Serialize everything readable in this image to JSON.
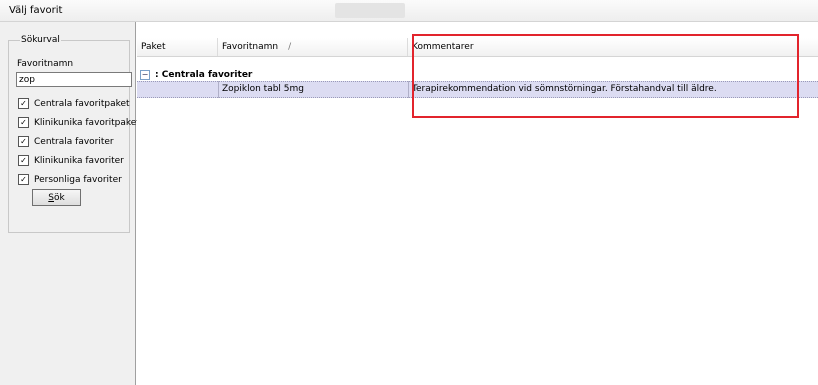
{
  "window": {
    "title": "Välj favorit"
  },
  "search": {
    "group_label": "Sökurval",
    "name_label": "Favoritnamn",
    "name_value": "zop",
    "checkboxes": [
      {
        "label": "Centrala favoritpaket",
        "checked": true,
        "mark": "✓"
      },
      {
        "label": "Klinikunika favoritpaket",
        "checked": true,
        "mark": "✓"
      },
      {
        "label": "Centrala favoriter",
        "checked": true,
        "mark": "✓"
      },
      {
        "label": "Klinikunika favoriter",
        "checked": true,
        "mark": "✓"
      },
      {
        "label": "Personliga favoriter",
        "checked": true,
        "mark": "✓"
      }
    ],
    "button_first": "S",
    "button_rest": "ök"
  },
  "grid": {
    "columns": [
      "Paket",
      "Favoritnamn",
      "Kommentarer"
    ],
    "sort_indicator": "/",
    "group": {
      "expander": "−",
      "label": ": Centrala favoriter"
    },
    "rows": [
      {
        "paket": "",
        "favoritnamn": "Zopiklon tabl 5mg",
        "kommentarer": "Terapirekommendation vid sömnstörningar. Förstahandval till äldre."
      }
    ]
  },
  "colors": {
    "highlight": "#e2242c",
    "selected_row": "#dcdcf2"
  }
}
